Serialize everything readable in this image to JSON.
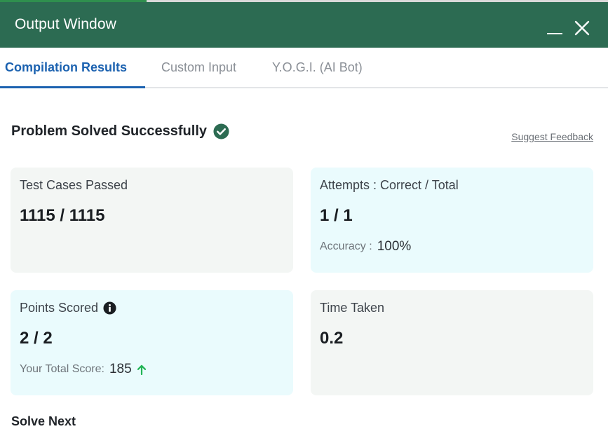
{
  "window": {
    "title": "Output Window",
    "minimize_icon": "minimize-icon",
    "close_icon": "close-icon"
  },
  "tabs": [
    {
      "label": "Compilation Results",
      "active": true
    },
    {
      "label": "Custom Input",
      "active": false
    },
    {
      "label": "Y.O.G.I. (AI Bot)",
      "active": false
    }
  ],
  "result": {
    "heading": "Problem Solved Successfully",
    "heading_icon": "check-circle-icon",
    "feedback_link": "Suggest Feedback"
  },
  "cards": {
    "test_cases": {
      "label": "Test Cases Passed",
      "value": "1115 / 1115"
    },
    "attempts": {
      "label": "Attempts : Correct / Total",
      "value": "1 / 1",
      "accuracy_label": "Accuracy :",
      "accuracy_value": "100%"
    },
    "points": {
      "label": "Points Scored",
      "value": "2 / 2",
      "total_label": "Your Total Score:",
      "total_value": "185",
      "info_icon": "info-icon",
      "trend_icon": "arrow-up-icon"
    },
    "time": {
      "label": "Time Taken",
      "value": "0.2"
    }
  },
  "solve_next": "Solve Next",
  "colors": {
    "titlebar": "#2c6b52",
    "active_tab": "#1c62b0",
    "success": "#2c6b52",
    "trend_up": "#22b455"
  }
}
